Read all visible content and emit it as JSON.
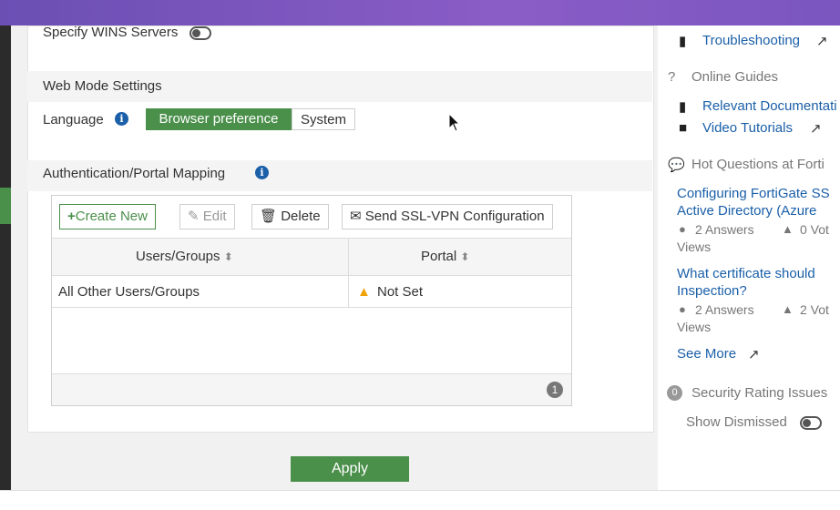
{
  "wins": {
    "label": "Specify WINS Servers"
  },
  "web_mode": {
    "heading": "Web Mode Settings",
    "language_label": "Language",
    "options": [
      "Browser preference",
      "System"
    ],
    "selected": "Browser preference"
  },
  "mapping": {
    "heading": "Authentication/Portal Mapping",
    "toolbar": {
      "create": "Create New",
      "edit": "Edit",
      "delete": "Delete",
      "send": "Send SSL-VPN Configuration"
    },
    "columns": [
      "Users/Groups",
      "Portal"
    ],
    "rows": [
      {
        "users": "All Other Users/Groups",
        "portal": "Not Set"
      }
    ],
    "count": "1"
  },
  "apply_label": "Apply",
  "sidebar": {
    "troubleshooting": "Troubleshooting",
    "online_guides": "Online Guides",
    "relevant_docs": "Relevant Documentati",
    "video_tutorials": "Video Tutorials",
    "hot_questions": "Hot Questions at Forti",
    "q1_title_1": "Configuring FortiGate SS",
    "q1_title_2": "Active Directory (Azure",
    "q1_answers": "2 Answers",
    "q1_votes": "0 Vot",
    "q1_views": "Views",
    "q2_title_1": "What certificate should",
    "q2_title_2": "Inspection?",
    "q2_answers": "2 Answers",
    "q2_votes": "2 Vot",
    "q2_views": "Views",
    "see_more": "See More",
    "security_count": "0",
    "security_label": "Security Rating Issues",
    "show_dismissed": "Show Dismissed"
  },
  "colors": {
    "accent_green": "#4a8f4a",
    "link_blue": "#1a5fa8",
    "warning": "#f0a30a",
    "top_bar": "#7b56bf"
  }
}
